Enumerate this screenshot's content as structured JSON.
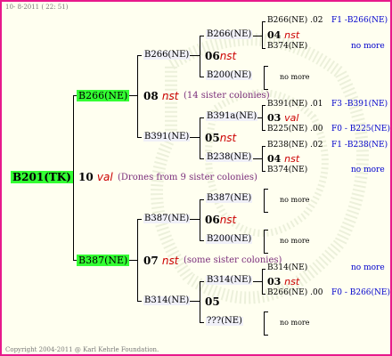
{
  "header": {
    "stamp": "10-  8-2011 ( 22: 51)"
  },
  "footer": {
    "copyright": "Copyright 2004-2011 @ Karl Kehrle Foundation."
  },
  "colors": {
    "border": "#e8198b",
    "highlight": "#33ff33",
    "generation_code": "#cc0000",
    "note": "#7a2d7a",
    "link": "#0000cc"
  },
  "root": {
    "id": "B201(TK)",
    "generation": "10",
    "mark": "val",
    "note": "(Drones from 9 sister colonies)"
  },
  "upper": {
    "id": "B266(NE)",
    "generation": "08",
    "mark": "nst",
    "note": "(14 sister colonies)",
    "left": {
      "id": "B266(NE)",
      "generation": "06",
      "mark": "nst",
      "left": {
        "id": "B266(NE)",
        "generation": "04",
        "mark": "nst",
        "left": {
          "id": "B266(NE)",
          "year": ".02",
          "link": "F1 -B266(NE)"
        },
        "right": {
          "id": "B374(NE)",
          "link": "no more"
        }
      },
      "right": {
        "id": "B200(NE)",
        "more": "no more"
      }
    },
    "right": {
      "id": "B391(NE)",
      "generation": "05",
      "mark": "nst",
      "left": {
        "id": "B391a(NE)",
        "generation": "03",
        "mark": "val",
        "left": {
          "id": "B391(NE)",
          "year": ".01",
          "link": "F3 -B391(NE)"
        },
        "right": {
          "id": "B225(NE)",
          "year": ".00",
          "link": "F0 - B225(NE)"
        }
      },
      "right": {
        "id": "B238(NE)",
        "generation": "04",
        "mark": "nst",
        "left": {
          "id": "B238(NE)",
          "year": ".02",
          "link": "F1 -B238(NE)"
        },
        "right": {
          "id": "B374(NE)",
          "link": "no more"
        }
      }
    }
  },
  "lower": {
    "id": "B387(NE)",
    "generation": "07",
    "mark": "nst",
    "note": "(some sister colonies)",
    "left": {
      "id": "B387(NE)",
      "generation": "06",
      "mark": "nst",
      "left": {
        "id": "B387(NE)",
        "more": "no more"
      },
      "right": {
        "id": "B200(NE)",
        "more": "no more"
      }
    },
    "right": {
      "id": "B314(NE)",
      "generation": "05",
      "left": {
        "id": "B314(NE)",
        "generation": "03",
        "mark": "nst",
        "left": {
          "id": "B314(NE)",
          "link": "no more"
        },
        "right": {
          "id": "B266(NE)",
          "year": ".00",
          "link": "F0 - B266(NE)"
        }
      },
      "right": {
        "id": "???(NE)",
        "more": "no more"
      }
    }
  }
}
